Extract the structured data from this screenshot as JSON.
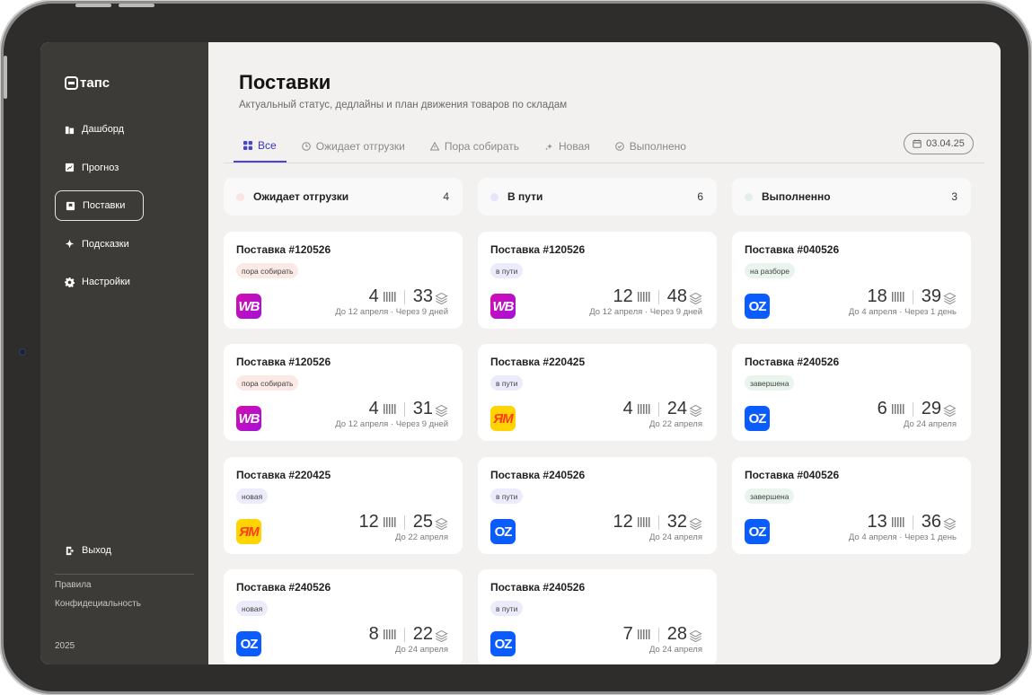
{
  "brand": "тапс",
  "sidebar": {
    "items": [
      {
        "label": "Дашборд",
        "icon": "dashboard-icon",
        "active": false
      },
      {
        "label": "Прогноз",
        "icon": "forecast-icon",
        "active": false
      },
      {
        "label": "Поставки",
        "icon": "box-icon",
        "active": true
      },
      {
        "label": "Подсказки",
        "icon": "sparkle-icon",
        "active": false
      },
      {
        "label": "Настройки",
        "icon": "gear-icon",
        "active": false
      }
    ],
    "logout": "Выход",
    "rules": "Правила",
    "privacy": "Конфидециальность",
    "year": "2025"
  },
  "page": {
    "title": "Поставки",
    "subtitle": "Актуальный статус, дедлайны и план движения товаров по складам"
  },
  "tabs": [
    {
      "label": "Все",
      "icon": "grid-icon",
      "active": true
    },
    {
      "label": "Ожидает отгрузки",
      "icon": "clock-icon",
      "active": false
    },
    {
      "label": "Пора собирать",
      "icon": "warning-icon",
      "active": false
    },
    {
      "label": "Новая",
      "icon": "sparkle-icon",
      "active": false
    },
    {
      "label": "Выполнено",
      "icon": "check-circle-icon",
      "active": false
    }
  ],
  "date_filter": "03.04.25",
  "summary": [
    {
      "label": "Ожидает отгрузки",
      "count": "4",
      "color": "#fbe3e0"
    },
    {
      "label": "В пути",
      "count": "6",
      "color": "#e6e4fb"
    },
    {
      "label": "Выполненно",
      "count": "3",
      "color": "#e2f1e7"
    }
  ],
  "colors": {
    "accent": "#4a44d6",
    "badge_red": "#fbe9e6",
    "badge_blue": "#ecebfb",
    "badge_green": "#e8f4ec"
  },
  "cards": [
    {
      "title": "Поставка #120526",
      "badge": "пора собирать",
      "badge_type": "red",
      "marketplace": "WB",
      "units": "4",
      "boxes": "33",
      "due": "До 12 апреля · Через 9 дней"
    },
    {
      "title": "Поставка #120526",
      "badge": "в пути",
      "badge_type": "blue",
      "marketplace": "WB",
      "units": "12",
      "boxes": "48",
      "due": "До 12 апреля · Через 9 дней"
    },
    {
      "title": "Поставка #040526",
      "badge": "на разборе",
      "badge_type": "green",
      "marketplace": "OZ",
      "units": "18",
      "boxes": "39",
      "due": "До 4 апреля · Через 1 день"
    },
    {
      "title": "Поставка #120526",
      "badge": "пора собирать",
      "badge_type": "red",
      "marketplace": "WB",
      "units": "4",
      "boxes": "31",
      "due": "До 12 апреля · Через 9 дней"
    },
    {
      "title": "Поставка #220425",
      "badge": "в пути",
      "badge_type": "blue",
      "marketplace": "ЯМ",
      "units": "4",
      "boxes": "24",
      "due": "До 22 апреля"
    },
    {
      "title": "Поставка #240526",
      "badge": "завершена",
      "badge_type": "green",
      "marketplace": "OZ",
      "units": "6",
      "boxes": "29",
      "due": "До 24 апреля"
    },
    {
      "title": "Поставка #220425",
      "badge": "новая",
      "badge_type": "blue",
      "marketplace": "ЯМ",
      "units": "12",
      "boxes": "25",
      "due": "До 22 апреля"
    },
    {
      "title": "Поставка #240526",
      "badge": "в пути",
      "badge_type": "blue",
      "marketplace": "OZ",
      "units": "12",
      "boxes": "32",
      "due": "До 24 апреля"
    },
    {
      "title": "Поставка #040526",
      "badge": "завершена",
      "badge_type": "green",
      "marketplace": "OZ",
      "units": "13",
      "boxes": "36",
      "due": "До 4 апреля · Через 1 день"
    },
    {
      "title": "Поставка #240526",
      "badge": "новая",
      "badge_type": "blue",
      "marketplace": "OZ",
      "units": "8",
      "boxes": "22",
      "due": "До 24 апреля"
    },
    {
      "title": "Поставка #240526",
      "badge": "в пути",
      "badge_type": "blue",
      "marketplace": "OZ",
      "units": "7",
      "boxes": "28",
      "due": "До 24 апреля"
    }
  ]
}
